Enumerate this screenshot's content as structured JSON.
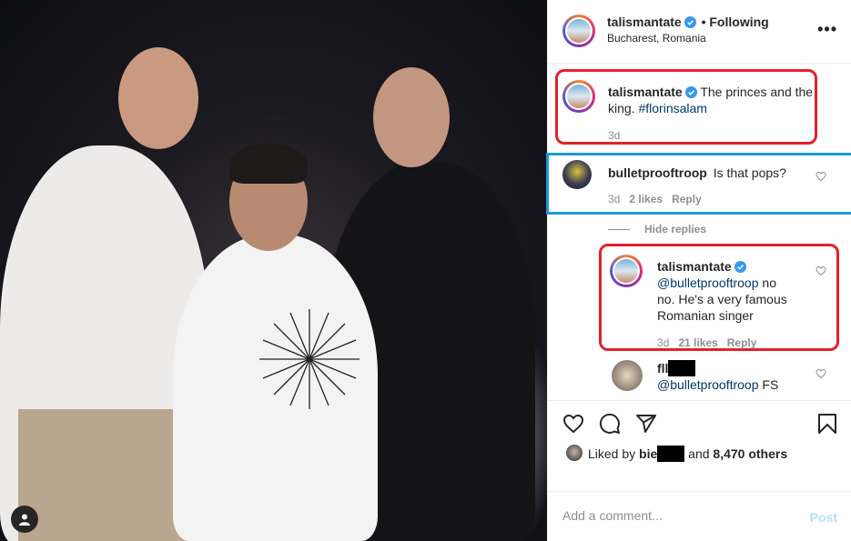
{
  "post": {
    "author": "talismantate",
    "follow_status": "• Following",
    "location": "Bucharest, Romania"
  },
  "caption": {
    "author": "talismantate",
    "text": "The princes and the king.",
    "hashtag": "#florinsalam",
    "time": "3d"
  },
  "comments": [
    {
      "author": "bulletprooftroop",
      "text": "Is that pops?",
      "time": "3d",
      "likes": "2 likes",
      "reply_label": "Reply"
    }
  ],
  "hide_replies_label": "Hide replies",
  "replies": [
    {
      "author": "talismantate",
      "mention": "@bulletprooftroop",
      "text": "no no. He's a very famous Romanian singer",
      "time": "3d",
      "likes": "21 likes",
      "reply_label": "Reply"
    },
    {
      "author": "fll",
      "mention": "@bulletprooftroop",
      "text": "FS"
    }
  ],
  "likes": {
    "prefix": "Liked by",
    "user": "bie",
    "middle": "and",
    "others": "8,470 others"
  },
  "add_comment": {
    "placeholder": "Add a comment...",
    "post_label": "Post"
  },
  "colors": {
    "highlight_red": "#e5202a",
    "highlight_blue": "#1b9ad6",
    "link": "#00376b",
    "verified": "#3897f0",
    "post_disabled": "#b2dffc"
  },
  "icons": [
    "more-options-icon",
    "verified-icon",
    "heart-icon",
    "comment-icon",
    "share-icon",
    "save-icon",
    "user-tag-icon"
  ]
}
